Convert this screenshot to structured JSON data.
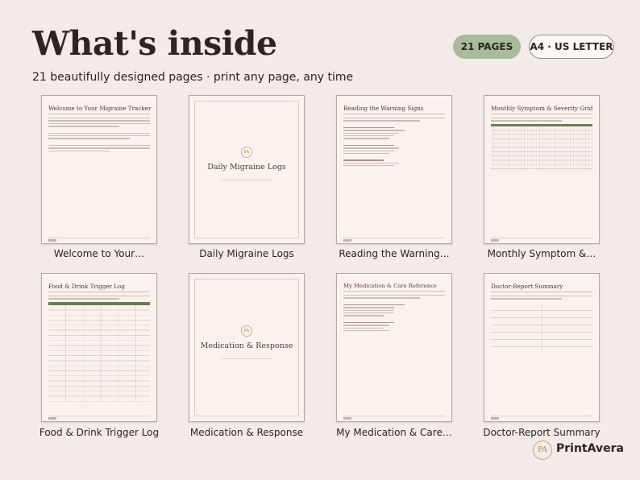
{
  "header": {
    "title": "What's inside",
    "subtitle": "21 beautifully designed pages · print any page, any time",
    "badge_pages": "21 PAGES",
    "badge_size": "A4 · US LETTER"
  },
  "pages": [
    {
      "caption": "Welcome to Your…",
      "heading": "Welcome to Your Migraine Tracker"
    },
    {
      "caption": "Daily Migraine Logs",
      "heading": "Daily Migraine Logs"
    },
    {
      "caption": "Reading the Warning…",
      "heading": "Reading the Warning Signs"
    },
    {
      "caption": "Monthly Symptom &…",
      "heading": "Monthly Symptom & Severity Grid"
    },
    {
      "caption": "Food & Drink Trigger Log",
      "heading": "Food & Drink Trigger Log"
    },
    {
      "caption": "Medication & Response",
      "heading": "Medication & Response"
    },
    {
      "caption": "My Medication & Care…",
      "heading": "My Medication & Care Reference"
    },
    {
      "caption": "Doctor-Report Summary",
      "heading": "Doctor-Report Summary"
    }
  ],
  "brand": {
    "monogram": "PA",
    "name": "PrintAvera"
  },
  "colors": {
    "background": "#f3ebe7",
    "accent_green": "#a8bb9b",
    "table_header": "#6b7a5b",
    "gold": "#c9a86a"
  }
}
